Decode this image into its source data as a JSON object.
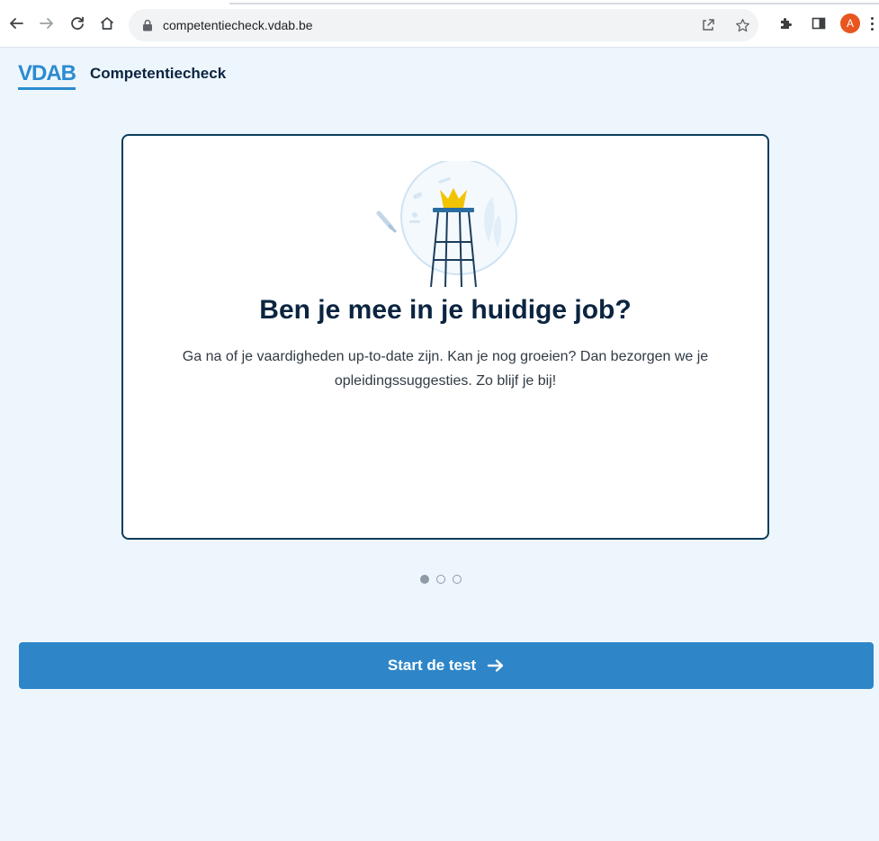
{
  "browser": {
    "url": "competentiecheck.vdab.be",
    "profile_initial": "A",
    "icons": {
      "back": "arrow-left-icon",
      "forward": "arrow-right-icon",
      "reload": "reload-icon",
      "home": "home-icon",
      "lock": "lock-icon",
      "share": "share-icon",
      "bookmark": "star-icon",
      "extensions": "puzzle-icon",
      "sidepanel": "side-panel-icon",
      "menu": "kebab-menu-icon"
    }
  },
  "header": {
    "logo_text": "VDAB",
    "app_title": "Competentiecheck"
  },
  "card": {
    "title": "Ben je mee in je huidige job?",
    "text": "Ga na of je vaardigheden up-to-date zijn. Kan je nog groeien? Dan bezorgen we je opleidingssuggesties. Zo blijf je bij!",
    "illustration": "stool-with-crown-illustration"
  },
  "carousel": {
    "total_slides": 3,
    "active_slide": 1
  },
  "cta": {
    "label": "Start de test",
    "icon": "arrow-right-icon"
  },
  "colors": {
    "page_bg": "#eef6fd",
    "brand_blue": "#2b8bd0",
    "button_blue": "#2e86c9",
    "navy": "#0b2440",
    "card_border": "#0b3d5c",
    "crown_yellow": "#f2c400"
  }
}
